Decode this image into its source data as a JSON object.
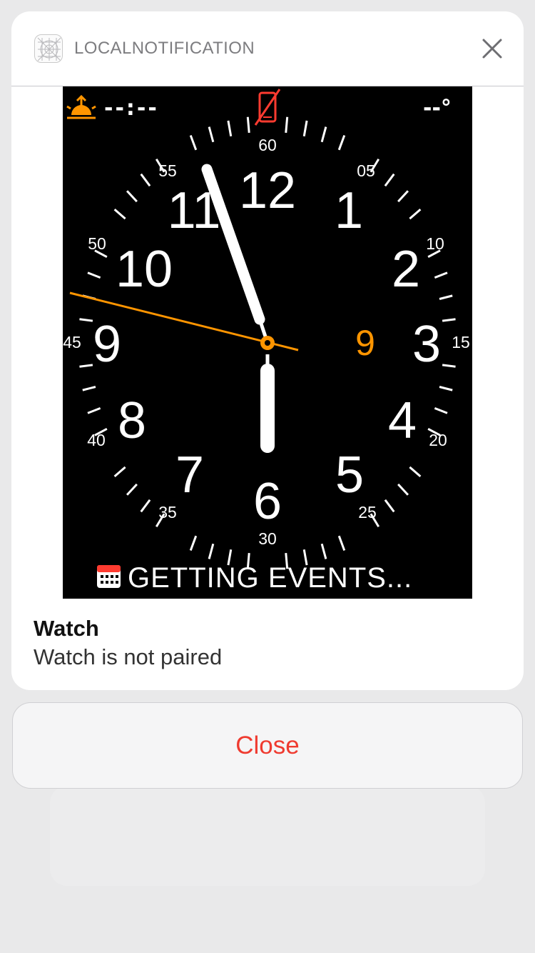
{
  "notification": {
    "app_name": "LOCALNOTIFICATION",
    "app_icon": "grid-icon",
    "dismiss_icon": "close-x-icon",
    "title": "Watch",
    "body": "Watch is not paired"
  },
  "watch_face": {
    "complication_top_left": "--:--",
    "complication_top_left_icon": "sunrise-icon",
    "complication_top_center_icon": "phone-disconnected-icon",
    "complication_top_right": "--°",
    "hour_numerals": [
      "12",
      "1",
      "2",
      "3",
      "4",
      "5",
      "6",
      "7",
      "8",
      "9",
      "10",
      "11"
    ],
    "minute_labels": [
      "60",
      "05",
      "10",
      "15",
      "20",
      "25",
      "30",
      "35",
      "40",
      "45",
      "50",
      "55"
    ],
    "date_value": "9",
    "calendar_icon": "calendar-icon",
    "bottom_text": "GETTING EVENTS...",
    "accent_color": "#ff9500",
    "alert_color": "#ff3b30"
  },
  "action": {
    "close_label": "Close",
    "color": "#ef3b30"
  }
}
